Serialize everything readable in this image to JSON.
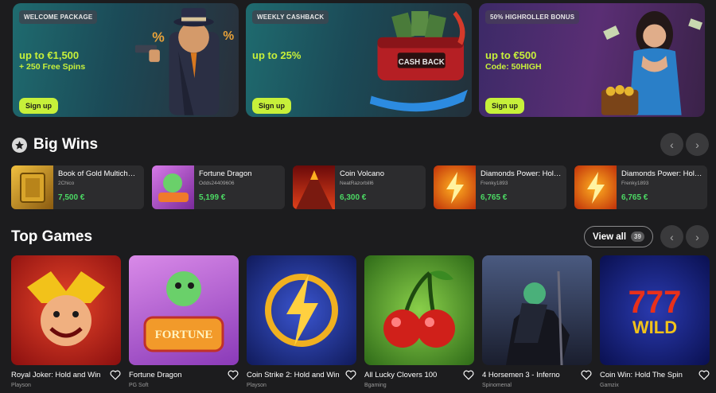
{
  "promos": [
    {
      "tag": "WELCOME PACKAGE",
      "headline": "up to €1,500",
      "sub": "+ 250 Free Spins",
      "button": "Sign up"
    },
    {
      "tag": "WEEKLY CASHBACK",
      "headline": "up to 25%",
      "sub": "",
      "button": "Sign up",
      "art_text": "CASH BACK"
    },
    {
      "tag": "50% HIGHROLLER BONUS",
      "headline": "up to €500",
      "sub": "Code: 50HIGH",
      "button": "Sign up"
    }
  ],
  "big_wins": {
    "title": "Big Wins",
    "items": [
      {
        "game": "Book of Gold Multichance",
        "user": "2Chico",
        "amount": "7,500 €",
        "thumb_color": "#c88a1a"
      },
      {
        "game": "Fortune Dragon",
        "user": "Odds24409606",
        "amount": "5,199 €",
        "thumb_color": "#b93fd0"
      },
      {
        "game": "Coin Volcano",
        "user": "NeatRazorbill6",
        "amount": "6,300 €",
        "thumb_color": "#b8261b"
      },
      {
        "game": "Diamonds Power: Hold and Win",
        "user": "Frenky1893",
        "amount": "6,765 €",
        "thumb_color": "#d8551a"
      },
      {
        "game": "Diamonds Power: Hold and Win",
        "user": "Frenky1893",
        "amount": "6,765 €",
        "thumb_color": "#d8551a"
      }
    ]
  },
  "top_games": {
    "title": "Top Games",
    "view_all_label": "View all",
    "view_all_count": "39",
    "items": [
      {
        "title": "Royal Joker: Hold and Win",
        "provider": "Playson",
        "bg": "#c6231d"
      },
      {
        "title": "Fortune Dragon",
        "provider": "PG Soft",
        "bg": "#b85ad6"
      },
      {
        "title": "Coin Strike 2: Hold and Win",
        "provider": "Playson",
        "bg": "#2a3d9e"
      },
      {
        "title": "All Lucky Clovers 100",
        "provider": "Bgaming",
        "bg": "#4f9a2a"
      },
      {
        "title": "4 Horsemen 3 - Inferno",
        "provider": "Spinomenal",
        "bg": "#2e3855"
      },
      {
        "title": "Coin Win: Hold The Spin",
        "provider": "Gamzix",
        "bg": "#1a2a8a"
      }
    ]
  },
  "colors": {
    "accent": "#c7f03a",
    "win": "#4cd964"
  }
}
